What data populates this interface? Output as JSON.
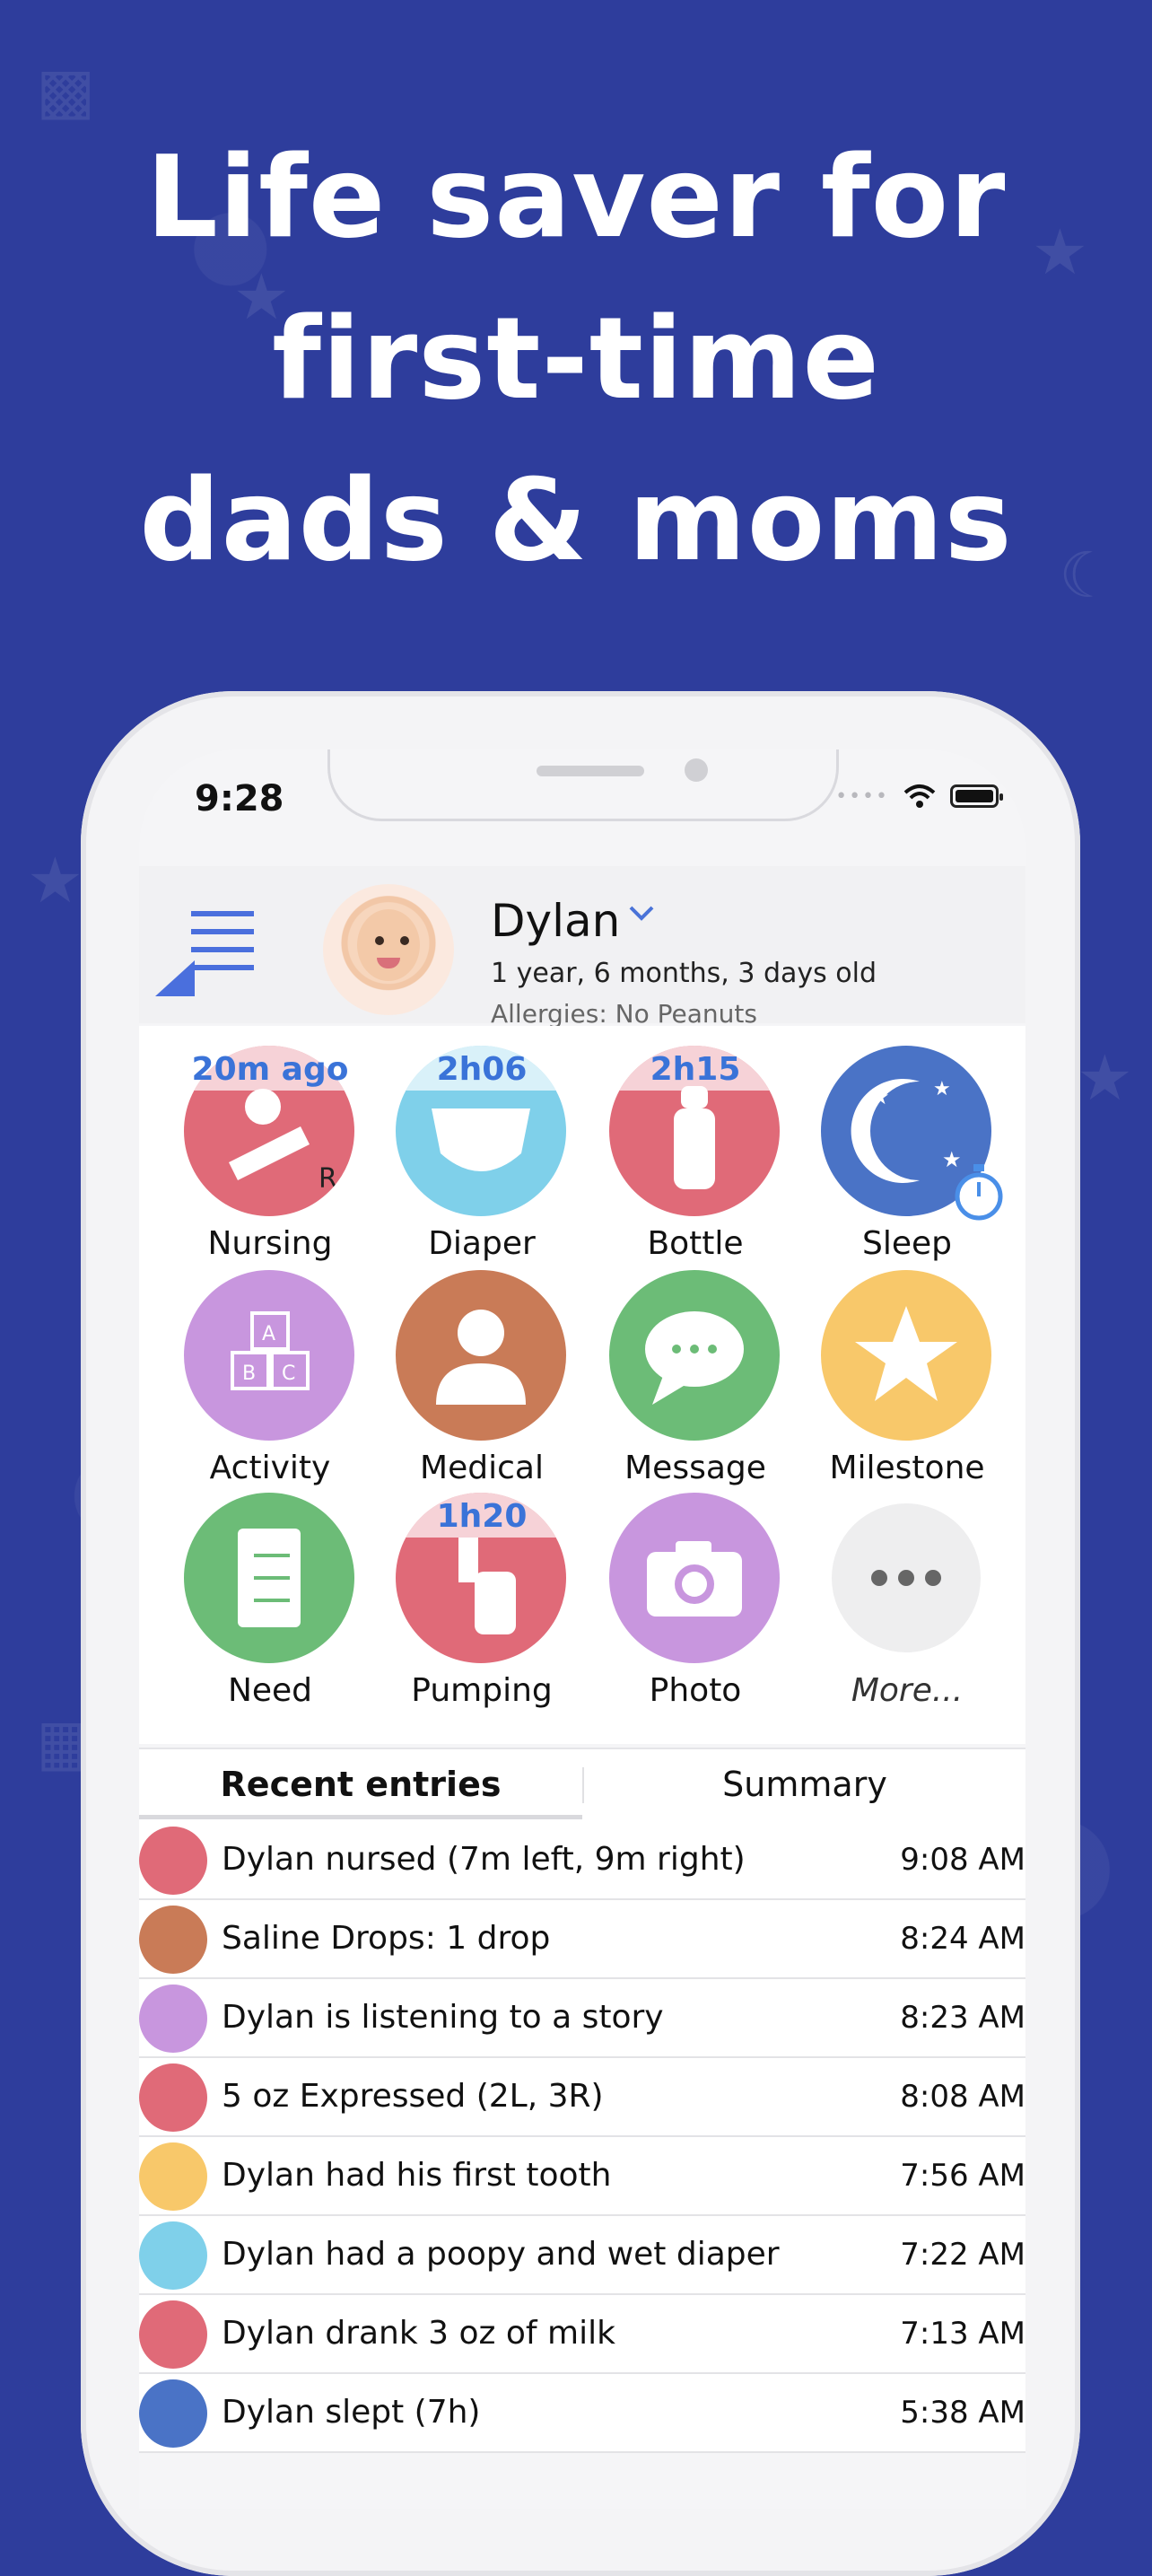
{
  "headline": [
    "Life saver for",
    "first-time",
    "dads & moms"
  ],
  "status_bar": {
    "time": "9:28"
  },
  "profile": {
    "name": "Dylan",
    "age": "1 year, 6 months, 3 days old",
    "allergies": "Allergies: No Peanuts"
  },
  "tiles": [
    {
      "label": "Nursing",
      "badge": "20m ago",
      "color": "#e06a78",
      "icon": "nursing-icon"
    },
    {
      "label": "Diaper",
      "badge": "2h06",
      "color": "#7fd0ea",
      "icon": "diaper-icon"
    },
    {
      "label": "Bottle",
      "badge": "2h15",
      "color": "#e06a78",
      "icon": "bottle-icon"
    },
    {
      "label": "Sleep",
      "badge": "",
      "color": "#4a73c6",
      "icon": "moon-icon"
    },
    {
      "label": "Activity",
      "badge": "",
      "color": "#c896de",
      "icon": "blocks-icon"
    },
    {
      "label": "Medical",
      "badge": "",
      "color": "#c97b57",
      "icon": "doctor-icon"
    },
    {
      "label": "Message",
      "badge": "",
      "color": "#6cbc77",
      "icon": "chat-icon"
    },
    {
      "label": "Milestone",
      "badge": "",
      "color": "#f8c86a",
      "icon": "star-icon"
    },
    {
      "label": "Need",
      "badge": "",
      "color": "#6cbc77",
      "icon": "checklist-icon"
    },
    {
      "label": "Pumping",
      "badge": "1h20",
      "color": "#e06a78",
      "icon": "pump-icon"
    },
    {
      "label": "Photo",
      "badge": "",
      "color": "#c896de",
      "icon": "camera-icon"
    },
    {
      "label": "More...",
      "badge": "",
      "color": "#eeeeef",
      "icon": "more-icon"
    }
  ],
  "tabs": {
    "recent": "Recent entries",
    "summary": "Summary"
  },
  "entries": [
    {
      "text": "Dylan nursed (7m left, 9m right)",
      "time": "9:08 AM",
      "color": "#e06a78",
      "icon": "nursing-icon"
    },
    {
      "text": "Saline Drops: 1 drop",
      "time": "8:24 AM",
      "color": "#c97b57",
      "icon": "medicine-icon"
    },
    {
      "text": "Dylan is listening to a story",
      "time": "8:23 AM",
      "color": "#c896de",
      "icon": "blocks-icon"
    },
    {
      "text": "5 oz Expressed (2L, 3R)",
      "time": "8:08 AM",
      "color": "#e06a78",
      "icon": "pump-icon"
    },
    {
      "text": "Dylan had his first tooth",
      "time": "7:56 AM",
      "color": "#f8c86a",
      "icon": "star-icon"
    },
    {
      "text": "Dylan had a poopy and wet diaper",
      "time": "7:22 AM",
      "color": "#7fd0ea",
      "icon": "diaper-icon"
    },
    {
      "text": "Dylan drank 3 oz of milk",
      "time": "7:13 AM",
      "color": "#e06a78",
      "icon": "bottle-icon"
    },
    {
      "text": "Dylan slept (7h)",
      "time": "5:38 AM",
      "color": "#4a73c6",
      "icon": "moon-icon"
    }
  ]
}
